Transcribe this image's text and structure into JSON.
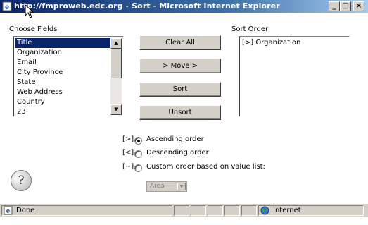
{
  "window": {
    "title": "http://fmproweb.edc.org - Sort - Microsoft Internet Explorer",
    "minimize": "_",
    "maximize": "□",
    "close": "×"
  },
  "fields": {
    "label": "Choose Fields",
    "items": [
      "Title",
      "Organization",
      "Email",
      "City Province",
      "State",
      "Web Address",
      "Country",
      "23"
    ],
    "selected": "Title"
  },
  "buttons": {
    "clear_all": "Clear All",
    "move": "> Move >",
    "sort": "Sort",
    "unsort": "Unsort"
  },
  "sort_order": {
    "label": "Sort Order",
    "items": [
      "[>] Organization"
    ]
  },
  "order_options": [
    {
      "key": "[>]",
      "label": "Ascending order",
      "checked": true
    },
    {
      "key": "[<]",
      "label": "Descending order",
      "checked": false
    },
    {
      "key": "[~]",
      "label": "Custom order based on value list:",
      "checked": false
    }
  ],
  "value_list": {
    "value": "Area",
    "disabled": true
  },
  "help": {
    "glyph": "?"
  },
  "status": {
    "text": "Done",
    "zone": "Internet"
  },
  "icons": {
    "app": "ie-page-icon",
    "help": "help-icon",
    "status": "page-icon",
    "zone": "globe-icon"
  }
}
